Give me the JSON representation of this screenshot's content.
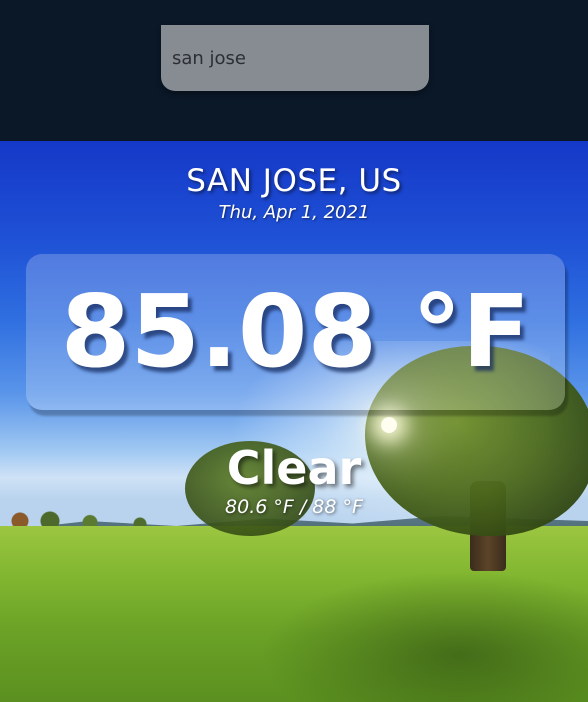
{
  "search": {
    "value": "san jose",
    "placeholder": ""
  },
  "location": {
    "city": "SAN JOSE, US",
    "date": "Thu, Apr 1, 2021"
  },
  "weather": {
    "temperature": "85.08 °F",
    "condition": "Clear",
    "range": "80.6 °F / 88 °F"
  },
  "colors": {
    "header_bg": "#0b1828",
    "search_bg": "#868c92",
    "text": "#ffffff"
  }
}
